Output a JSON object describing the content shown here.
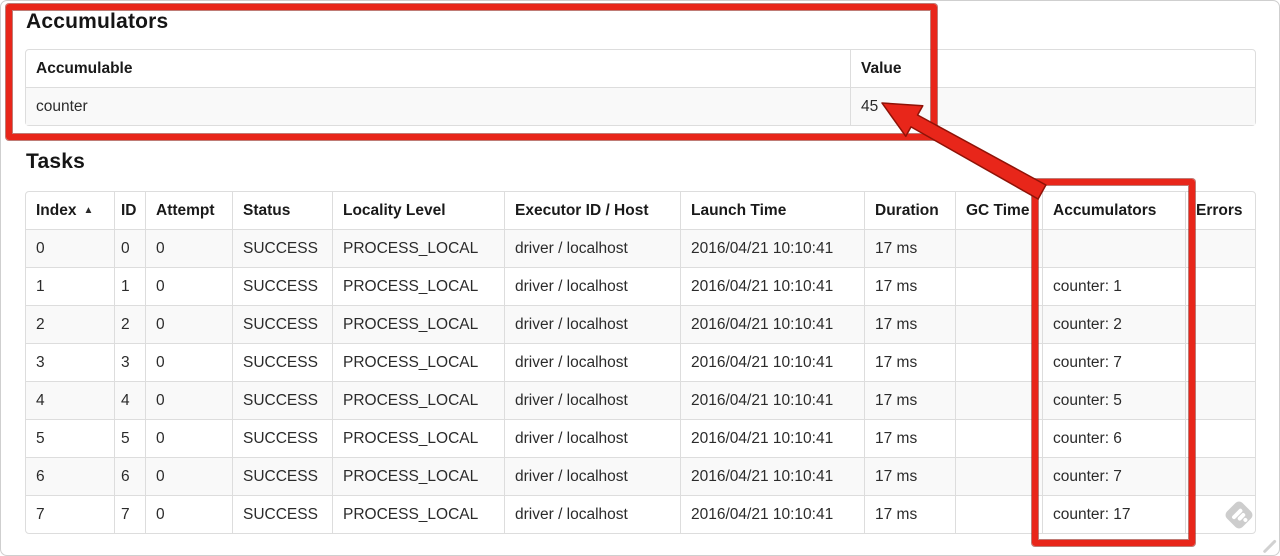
{
  "accumulators_section": {
    "title": "Accumulators",
    "table": {
      "headers": [
        "Accumulable",
        "Value"
      ],
      "rows": [
        [
          "counter",
          "45"
        ]
      ]
    }
  },
  "tasks_section": {
    "title": "Tasks",
    "table": {
      "headers": [
        "Index",
        "ID",
        "Attempt",
        "Status",
        "Locality Level",
        "Executor ID / Host",
        "Launch Time",
        "Duration",
        "GC Time",
        "Accumulators",
        "Errors"
      ],
      "sort_icon": "▲",
      "rows": [
        [
          "0",
          "0",
          "0",
          "SUCCESS",
          "PROCESS_LOCAL",
          "driver / localhost",
          "2016/04/21 10:10:41",
          "17 ms",
          "",
          "",
          ""
        ],
        [
          "1",
          "1",
          "0",
          "SUCCESS",
          "PROCESS_LOCAL",
          "driver / localhost",
          "2016/04/21 10:10:41",
          "17 ms",
          "",
          "counter: 1",
          ""
        ],
        [
          "2",
          "2",
          "0",
          "SUCCESS",
          "PROCESS_LOCAL",
          "driver / localhost",
          "2016/04/21 10:10:41",
          "17 ms",
          "",
          "counter: 2",
          ""
        ],
        [
          "3",
          "3",
          "0",
          "SUCCESS",
          "PROCESS_LOCAL",
          "driver / localhost",
          "2016/04/21 10:10:41",
          "17 ms",
          "",
          "counter: 7",
          ""
        ],
        [
          "4",
          "4",
          "0",
          "SUCCESS",
          "PROCESS_LOCAL",
          "driver / localhost",
          "2016/04/21 10:10:41",
          "17 ms",
          "",
          "counter: 5",
          ""
        ],
        [
          "5",
          "5",
          "0",
          "SUCCESS",
          "PROCESS_LOCAL",
          "driver / localhost",
          "2016/04/21 10:10:41",
          "17 ms",
          "",
          "counter: 6",
          ""
        ],
        [
          "6",
          "6",
          "0",
          "SUCCESS",
          "PROCESS_LOCAL",
          "driver / localhost",
          "2016/04/21 10:10:41",
          "17 ms",
          "",
          "counter: 7",
          ""
        ],
        [
          "7",
          "7",
          "0",
          "SUCCESS",
          "PROCESS_LOCAL",
          "driver / localhost",
          "2016/04/21 10:10:41",
          "17 ms",
          "",
          "counter: 17",
          ""
        ]
      ]
    }
  },
  "annotations": {
    "highlight_color": "#e8261a",
    "highlight_edge_color": "#8f1207",
    "accumulators_box": "around Accumulators summary",
    "column_box": "around Accumulators task column",
    "arrow": "points from Accumulators column to value 45"
  },
  "colors": {
    "table_border": "#dddddd",
    "striped_row": "#f9f9f9",
    "watermark_gray": "#c7c7c7"
  }
}
